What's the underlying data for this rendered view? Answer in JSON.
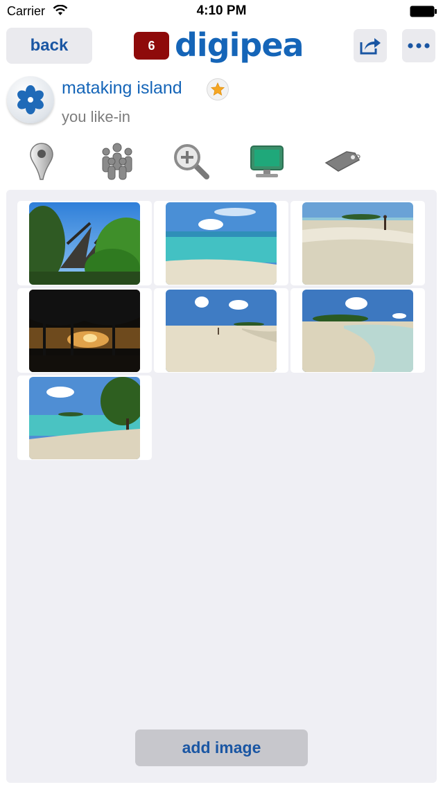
{
  "status_bar": {
    "carrier": "Carrier",
    "time": "4:10 PM"
  },
  "nav": {
    "back_label": "back",
    "badge_count": "6",
    "logo": "digipea",
    "share_icon": "share-icon",
    "more_icon": "more-icon"
  },
  "profile": {
    "name": "mataking island",
    "subtitle": "you like-in"
  },
  "toolbar": {
    "items": [
      {
        "icon": "map-pin-icon"
      },
      {
        "icon": "people-icon"
      },
      {
        "icon": "zoom-in-icon"
      },
      {
        "icon": "monitor-icon"
      },
      {
        "icon": "tag-icon"
      }
    ]
  },
  "gallery": {
    "images": [
      {
        "scene": "hut roof among trees"
      },
      {
        "scene": "turquoise sea and beach"
      },
      {
        "scene": "sandbar with person"
      },
      {
        "scene": "sunset behind trees"
      },
      {
        "scene": "white sand beach with island"
      },
      {
        "scene": "island across shallow water"
      },
      {
        "scene": "beach with tree and island"
      }
    ]
  },
  "actions": {
    "add_image_label": "add image"
  },
  "colors": {
    "accent": "#1565b8",
    "badge": "#8e0a0a",
    "panel": "#efeff4"
  }
}
